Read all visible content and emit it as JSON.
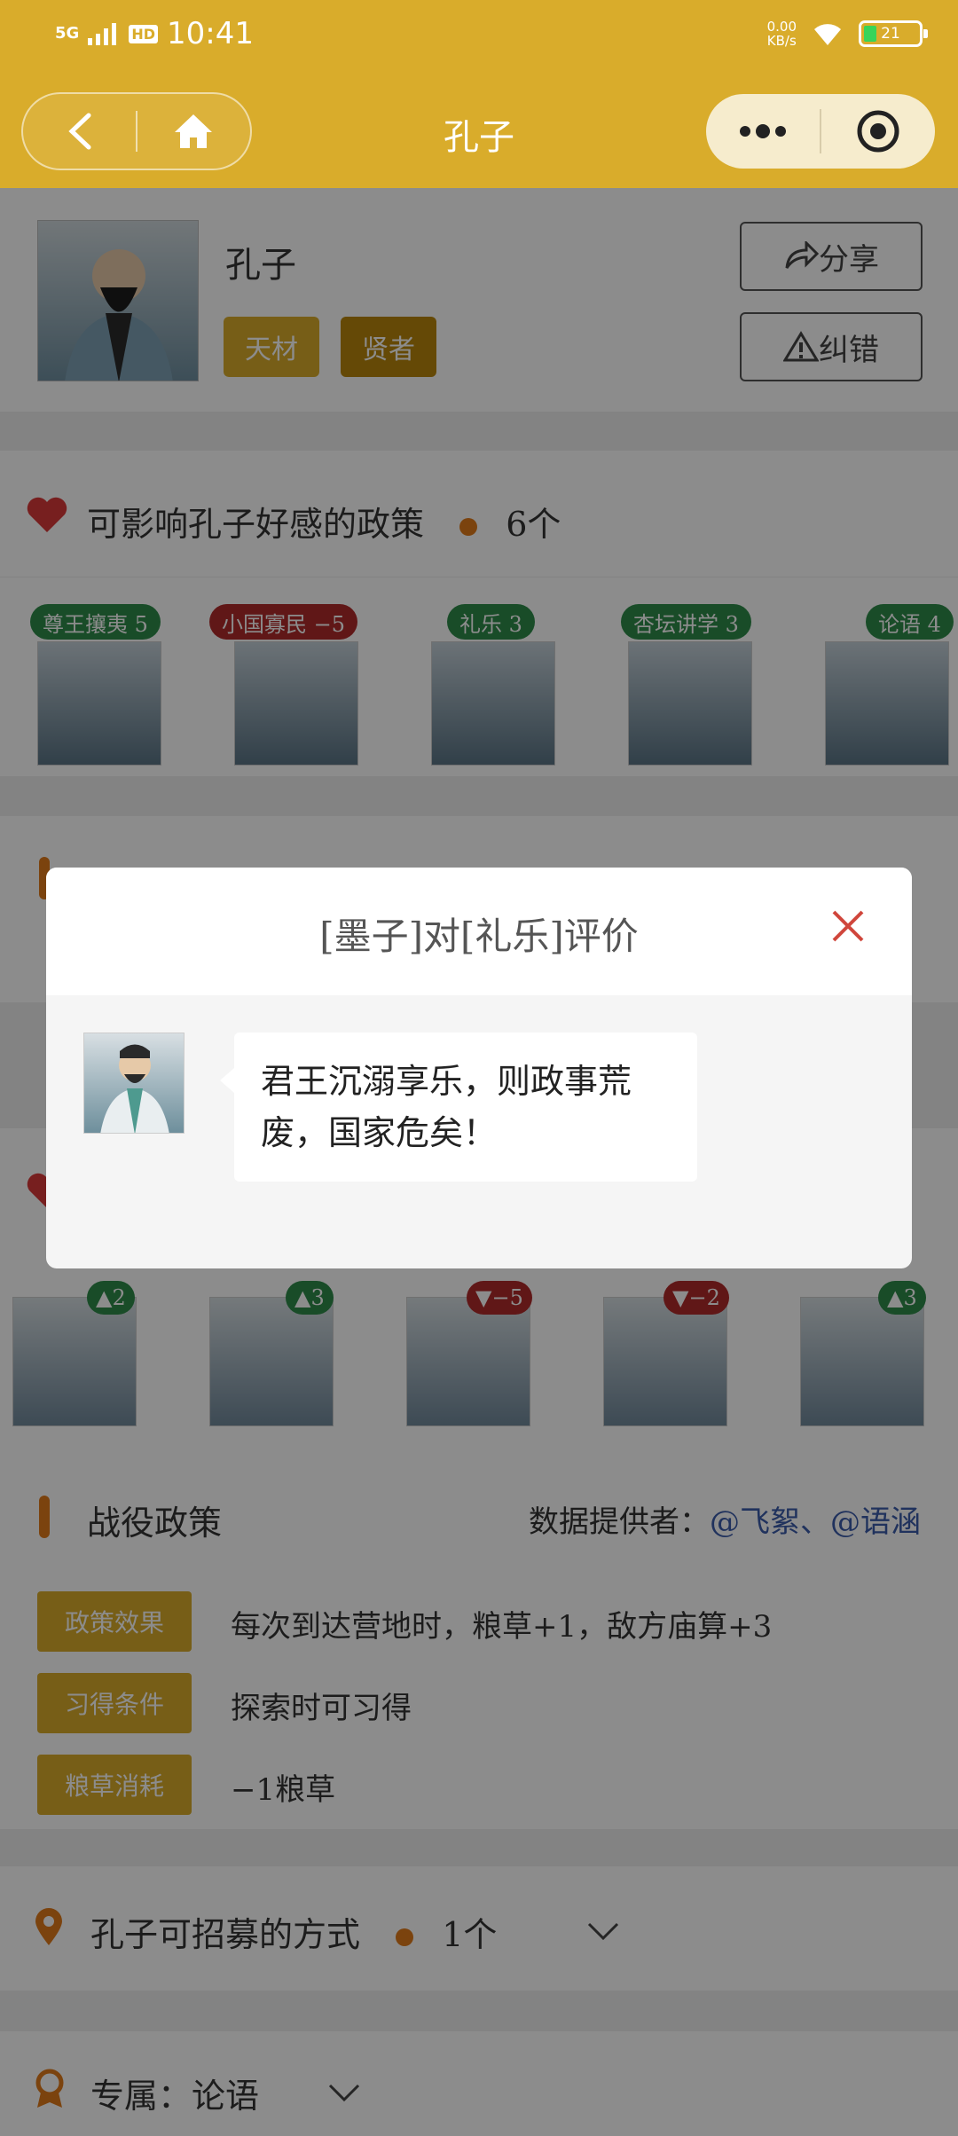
{
  "status": {
    "network": "5G",
    "hd": "HD",
    "time": "10:41",
    "speed_top": "0.00",
    "speed_unit": "KB/s",
    "battery": "21"
  },
  "nav": {
    "title": "孔子"
  },
  "profile": {
    "name": "孔子",
    "tags": [
      "天材",
      "贤者"
    ],
    "share_label": "分享",
    "report_label": "纠错"
  },
  "policy": {
    "heading": "可影响孔子好感的政策",
    "count": "6个",
    "items": [
      {
        "label": "尊王攘夷 5",
        "color": "#2e8b4a"
      },
      {
        "label": "小国寡民 −5",
        "color": "#b02a2a"
      },
      {
        "label": "礼乐 3",
        "color": "#2e8b4a"
      },
      {
        "label": "杏坛讲学 3",
        "color": "#2e8b4a"
      },
      {
        "label": "论语 4",
        "color": "#2e8b4a"
      }
    ]
  },
  "characters": [
    {
      "value": "2",
      "dir": "up"
    },
    {
      "value": "3",
      "dir": "up"
    },
    {
      "value": "−5",
      "dir": "down"
    },
    {
      "value": "−2",
      "dir": "down"
    },
    {
      "value": "3",
      "dir": "up"
    }
  ],
  "battle": {
    "heading": "战役政策",
    "provider_label": "数据提供者：",
    "providers": "@飞絮、@语涵",
    "fields": [
      {
        "tag": "政策效果",
        "value": "每次到达营地时，粮草+1，敌方庙算+3"
      },
      {
        "tag": "习得条件",
        "value": "探索时可习得"
      },
      {
        "tag": "粮草消耗",
        "value": "−1粮草"
      }
    ]
  },
  "recruit": {
    "heading": "孔子可招募的方式",
    "count": "1个"
  },
  "exclusive": {
    "label": "专属：论语"
  },
  "modal": {
    "title": "[墨子]对[礼乐]评价",
    "quote": "君王沉溺享乐，则政事荒废，国家危矣！"
  },
  "colors": {
    "brand": "#d9ac2b",
    "accent": "#e07a1a",
    "link": "#3b5ba9"
  }
}
